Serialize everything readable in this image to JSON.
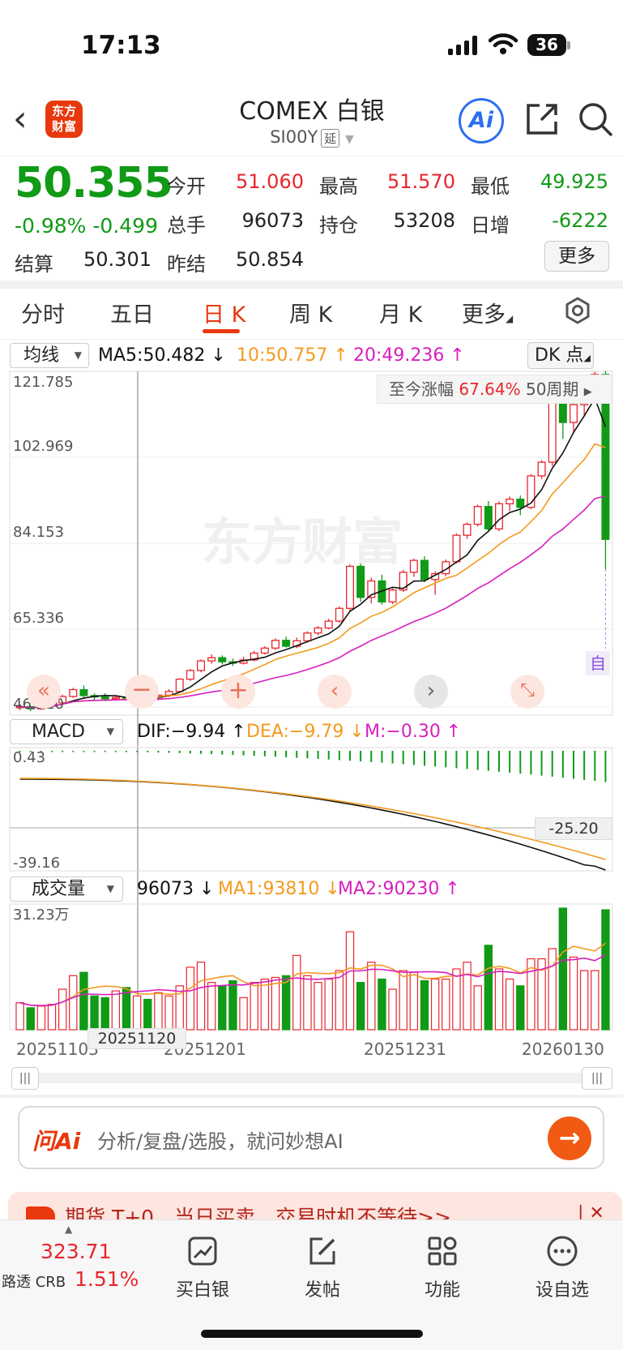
{
  "status_bar": {
    "time": "17:13",
    "battery": "36"
  },
  "header": {
    "logo_text_line1": "东方",
    "logo_text_line2": "财富",
    "title": "COMEX 白银",
    "code": "SI00Y",
    "delay_badge": "延",
    "ai_label": "Ai"
  },
  "quote": {
    "price": "50.355",
    "change_pct": "-0.98%",
    "change_abs": "-0.499",
    "open_label": "今开",
    "open": "51.060",
    "high_label": "最高",
    "high": "51.570",
    "low_label": "最低",
    "low": "49.925",
    "volume_label": "总手",
    "volume": "96073",
    "oi_label": "持仓",
    "oi": "53208",
    "daily_inc_label": "日增",
    "daily_inc": "-6222",
    "settle_label": "结算",
    "settle": "50.301",
    "prev_settle_label": "昨结",
    "prev_settle": "50.854",
    "more_label": "更多"
  },
  "tabs": [
    "分时",
    "五日",
    "日 K",
    "周 K",
    "月 K",
    "更多"
  ],
  "active_tab": "日 K",
  "kline_panel": {
    "indicator_select": "均线",
    "ma5": "MA5:50.482",
    "ma10": "10:50.757",
    "ma20": "20:49.236",
    "dk_label": "DK 点",
    "yaxis": [
      "121.785",
      "102.969",
      "84.153",
      "65.336",
      "46.520"
    ],
    "range_label": "至今涨幅",
    "range_value": "67.64%",
    "range_period": "50周期",
    "self_label": "自",
    "watermark": "东方财富"
  },
  "macd_panel": {
    "indicator_select": "MACD",
    "dif": "DIF:−9.94",
    "dea": "DEA:−9.79",
    "m": "M:−0.30",
    "ymax": "0.43",
    "ymin": "-39.16",
    "crosshair_value": "-25.20"
  },
  "volume_panel": {
    "indicator_select": "成交量",
    "vol": "96073",
    "ma1": "MA1:93810",
    "ma2": "MA2:90230",
    "ymax": "31.23万",
    "dates": [
      "20251103",
      "20251201",
      "20251231",
      "20260130"
    ],
    "crosshair_date": "20251120"
  },
  "ai_bar": {
    "label": "问Ai",
    "placeholder": "分析/复盘/选股，就问妙想AI"
  },
  "promo": {
    "text": "期货 T+0，当日买卖，交易时机不等待>>"
  },
  "bottom_nav": {
    "index_value": "323.71",
    "index_name": "路透 CRB",
    "index_change": "1.51%",
    "items": [
      "买白银",
      "发帖",
      "功能",
      "设自选"
    ]
  },
  "colors": {
    "up": "#e8262d",
    "down": "#109a16",
    "accent": "#e8380d",
    "ma10": "#f39a1e",
    "ma20": "#d81fbf"
  },
  "chart_data": {
    "type": "candlestick",
    "ylim": [
      46.52,
      121.785
    ],
    "candles": [
      [
        48.2,
        48.9,
        47.6,
        48.4
      ],
      [
        48.4,
        48.6,
        47.4,
        47.9
      ],
      [
        47.9,
        48.6,
        47.7,
        48.5
      ],
      [
        48.5,
        49.5,
        48.2,
        49.2
      ],
      [
        49.2,
        51.0,
        48.9,
        50.6
      ],
      [
        50.6,
        52.5,
        50.3,
        52.1
      ],
      [
        52.1,
        53.0,
        50.2,
        50.8
      ],
      [
        50.8,
        51.3,
        49.8,
        50.5
      ],
      [
        50.5,
        51.3,
        49.6,
        50.1
      ],
      [
        50.1,
        50.9,
        49.7,
        50.4
      ],
      [
        50.4,
        51.2,
        49.9,
        50.2
      ],
      [
        50.2,
        51.2,
        49.8,
        50.6
      ],
      [
        50.6,
        51.3,
        49.5,
        50.1
      ],
      [
        50.1,
        51.1,
        49.8,
        50.9
      ],
      [
        50.9,
        52.2,
        50.5,
        51.7
      ],
      [
        51.7,
        54.6,
        51.4,
        54.4
      ],
      [
        54.4,
        56.6,
        54.0,
        56.3
      ],
      [
        56.3,
        58.7,
        55.9,
        58.4
      ],
      [
        58.4,
        59.8,
        57.8,
        59.1
      ],
      [
        59.1,
        59.6,
        57.6,
        58.2
      ],
      [
        58.2,
        58.9,
        57.3,
        57.9
      ],
      [
        57.9,
        59.3,
        57.6,
        58.6
      ],
      [
        58.6,
        60.6,
        58.3,
        60.1
      ],
      [
        60.1,
        61.6,
        59.8,
        61.2
      ],
      [
        61.2,
        63.3,
        60.8,
        62.9
      ],
      [
        62.9,
        63.7,
        61.3,
        61.6
      ],
      [
        61.6,
        63.5,
        61.2,
        62.8
      ],
      [
        62.8,
        64.9,
        62.4,
        64.5
      ],
      [
        64.5,
        66.0,
        64.0,
        65.6
      ],
      [
        65.6,
        67.6,
        65.3,
        67.1
      ],
      [
        67.1,
        70.3,
        66.8,
        69.9
      ],
      [
        69.9,
        79.5,
        69.3,
        79.1
      ],
      [
        79.1,
        79.7,
        71.3,
        72.3
      ],
      [
        72.3,
        76.6,
        71.0,
        75.9
      ],
      [
        75.9,
        77.3,
        70.7,
        71.3
      ],
      [
        71.3,
        74.3,
        70.8,
        73.9
      ],
      [
        73.9,
        78.3,
        73.5,
        77.8
      ],
      [
        77.8,
        80.8,
        76.8,
        80.4
      ],
      [
        80.4,
        81.3,
        75.6,
        76.2
      ],
      [
        76.2,
        78.0,
        72.9,
        77.5
      ],
      [
        77.5,
        80.6,
        76.9,
        80.1
      ],
      [
        80.1,
        86.3,
        79.7,
        85.9
      ],
      [
        85.9,
        88.7,
        85.1,
        88.3
      ],
      [
        88.3,
        92.6,
        87.8,
        92.2
      ],
      [
        92.2,
        93.4,
        86.6,
        87.3
      ],
      [
        87.3,
        93.3,
        86.8,
        92.8
      ],
      [
        92.8,
        94.4,
        91.2,
        93.8
      ],
      [
        93.8,
        94.6,
        90.3,
        92.0
      ],
      [
        92.0,
        99.3,
        91.6,
        98.9
      ],
      [
        98.9,
        102.3,
        98.2,
        101.9
      ],
      [
        101.9,
        117.0,
        101.1,
        116.2
      ],
      [
        116.2,
        117.3,
        107.0,
        110.6
      ],
      [
        110.6,
        115.3,
        108.2,
        114.5
      ],
      [
        114.5,
        117.9,
        112.0,
        117.0
      ],
      [
        117.0,
        121.7,
        115.9,
        121.1
      ],
      [
        121.1,
        121.8,
        78.5,
        85.0
      ]
    ],
    "volume": [
      8,
      6.5,
      7,
      7.5,
      12,
      16,
      17,
      10,
      9.5,
      11.5,
      12.5,
      10,
      9,
      11,
      10,
      13,
      18.5,
      20,
      14,
      13,
      14.5,
      9.5,
      14,
      15,
      15.5,
      16,
      22,
      16,
      14,
      15,
      17.5,
      29,
      14,
      20,
      15,
      12,
      17.5,
      17,
      14.5,
      15,
      15,
      18,
      20,
      13,
      25,
      18,
      15,
      13,
      21,
      21,
      24,
      36,
      21.5,
      17.5,
      17.5,
      35.5
    ]
  }
}
